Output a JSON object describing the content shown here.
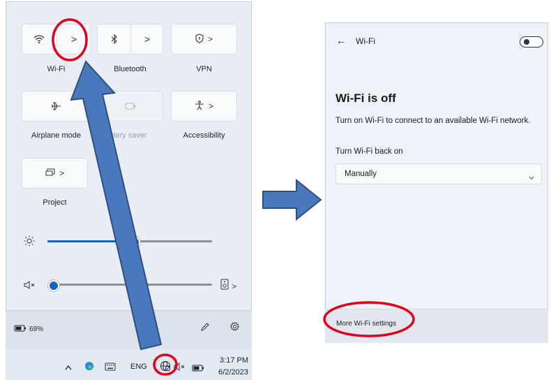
{
  "quick_settings": {
    "tiles": [
      {
        "label": "Wi-Fi",
        "icon": "wifi-icon",
        "has_chevron": true
      },
      {
        "label": "Bluetooth",
        "icon": "bluetooth-icon",
        "has_chevron": true
      },
      {
        "label": "VPN",
        "icon": "shield-icon",
        "has_chevron": true
      },
      {
        "label": "Airplane mode",
        "icon": "airplane-icon"
      },
      {
        "label": "tery saver",
        "icon": "battery-saver-icon"
      },
      {
        "label": "Accessibility",
        "icon": "accessibility-icon",
        "has_chevron": true
      },
      {
        "label": "Project",
        "icon": "project-icon",
        "has_chevron": true
      }
    ],
    "chevron": ">",
    "brightness_level": 0.52,
    "volume_level": 0.03,
    "battery": "69%"
  },
  "taskbar": {
    "language": "ENG",
    "time": "3:17 PM",
    "date": "6/2/2023"
  },
  "wifi_panel": {
    "back_arrow": "←",
    "header_title": "Wi-Fi",
    "toggle_on": false,
    "heading": "Wi-Fi is off",
    "description": "Turn on Wi-Fi to connect to an available Wi-Fi network.",
    "turn_back_label": "Turn Wi-Fi back on",
    "turn_back_value": "Manually",
    "more_settings_link": "More Wi-Fi settings"
  },
  "colors": {
    "accent": "#1464c0",
    "annotation_red": "#e3001b",
    "arrow_fill": "#4a78bd",
    "arrow_stroke": "#2f4f80"
  }
}
